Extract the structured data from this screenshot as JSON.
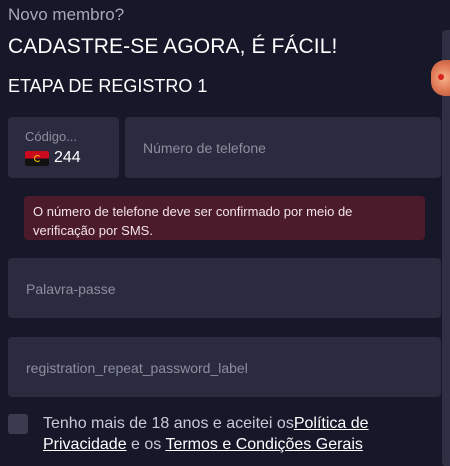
{
  "header": {
    "kicker": "Novo membro?",
    "headline": "CADASTRE-SE AGORA, É FÁCIL!",
    "step": "ETAPA DE REGISTRO 1"
  },
  "phone": {
    "code_label": "Código...",
    "code_value": "244",
    "country_flag": "angola-flag",
    "number_placeholder": "Número de telefone"
  },
  "alert": {
    "message": "O número de telefone deve ser confirmado por meio de verificação por SMS."
  },
  "password": {
    "placeholder": "Palavra-passe"
  },
  "repeat_password": {
    "placeholder": "registration_repeat_password_label"
  },
  "consent": {
    "checked": false,
    "text_before": "Tenho mais de 18 anos e aceitei os",
    "privacy_link": "Política de Privacidade",
    "text_middle": " e os ",
    "terms_link": "Termos e Condições Gerais"
  },
  "colors": {
    "background": "#161728",
    "field": "#2a2b3e",
    "alert": "#4b1b2b"
  }
}
